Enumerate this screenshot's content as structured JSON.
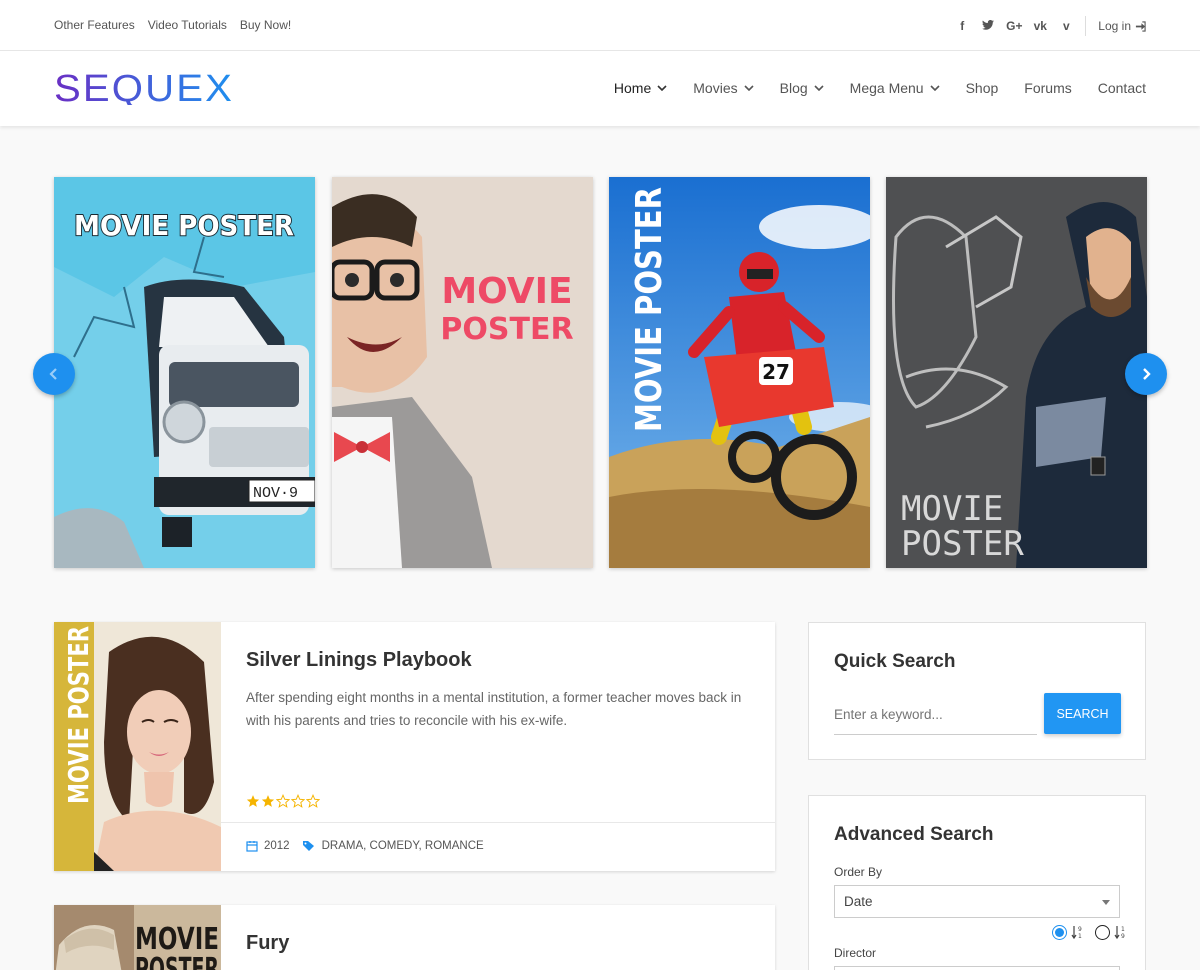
{
  "topbar": {
    "links": [
      "Other Features",
      "Video Tutorials",
      "Buy Now!"
    ],
    "social_icons": [
      "facebook-icon",
      "twitter-icon",
      "google-plus-icon",
      "vk-icon",
      "vimeo-icon"
    ],
    "social_glyphs": [
      "f",
      "t",
      "G+",
      "vk",
      "v"
    ],
    "login_label": "Log in"
  },
  "brand": {
    "logo_text": "SEQUEX",
    "gradient": [
      "#6a2fc4",
      "#1e90ef"
    ]
  },
  "nav": {
    "items": [
      {
        "label": "Home",
        "dropdown": true,
        "active": true
      },
      {
        "label": "Movies",
        "dropdown": true
      },
      {
        "label": "Blog",
        "dropdown": true
      },
      {
        "label": "Mega Menu",
        "dropdown": true
      },
      {
        "label": "Shop",
        "dropdown": false
      },
      {
        "label": "Forums",
        "dropdown": false
      },
      {
        "label": "Contact",
        "dropdown": false
      }
    ]
  },
  "carousel": {
    "posters": [
      {
        "title": "MOVIE POSTER",
        "plate": "NOV·9"
      },
      {
        "title_lines": [
          "MOVIE",
          "POSTER"
        ]
      },
      {
        "title": "MOVIE POSTER",
        "bike_number": "27"
      },
      {
        "title_lines": [
          "MOVIE",
          "POSTER"
        ]
      }
    ]
  },
  "movies": [
    {
      "title": "Silver Linings Playbook",
      "description": "After spending eight months in a mental institution, a former teacher moves back in with his parents and tries to reconcile with his ex-wife.",
      "rating": 2,
      "rating_max": 5,
      "year": "2012",
      "genres": "DRAMA, COMEDY, ROMANCE",
      "poster_text": "MOVIE POSTER"
    },
    {
      "title": "Fury",
      "poster_text_lines": [
        "MOVIE",
        "POSTER"
      ]
    }
  ],
  "quick_search": {
    "title": "Quick Search",
    "placeholder": "Enter a keyword...",
    "button_label": "SEARCH"
  },
  "advanced_search": {
    "title": "Advanced Search",
    "order_by_label": "Order By",
    "order_by_value": "Date",
    "sort_direction": "descending",
    "director_label": "Director"
  },
  "colors": {
    "accent": "#1e90ef",
    "star": "#f5b400"
  }
}
